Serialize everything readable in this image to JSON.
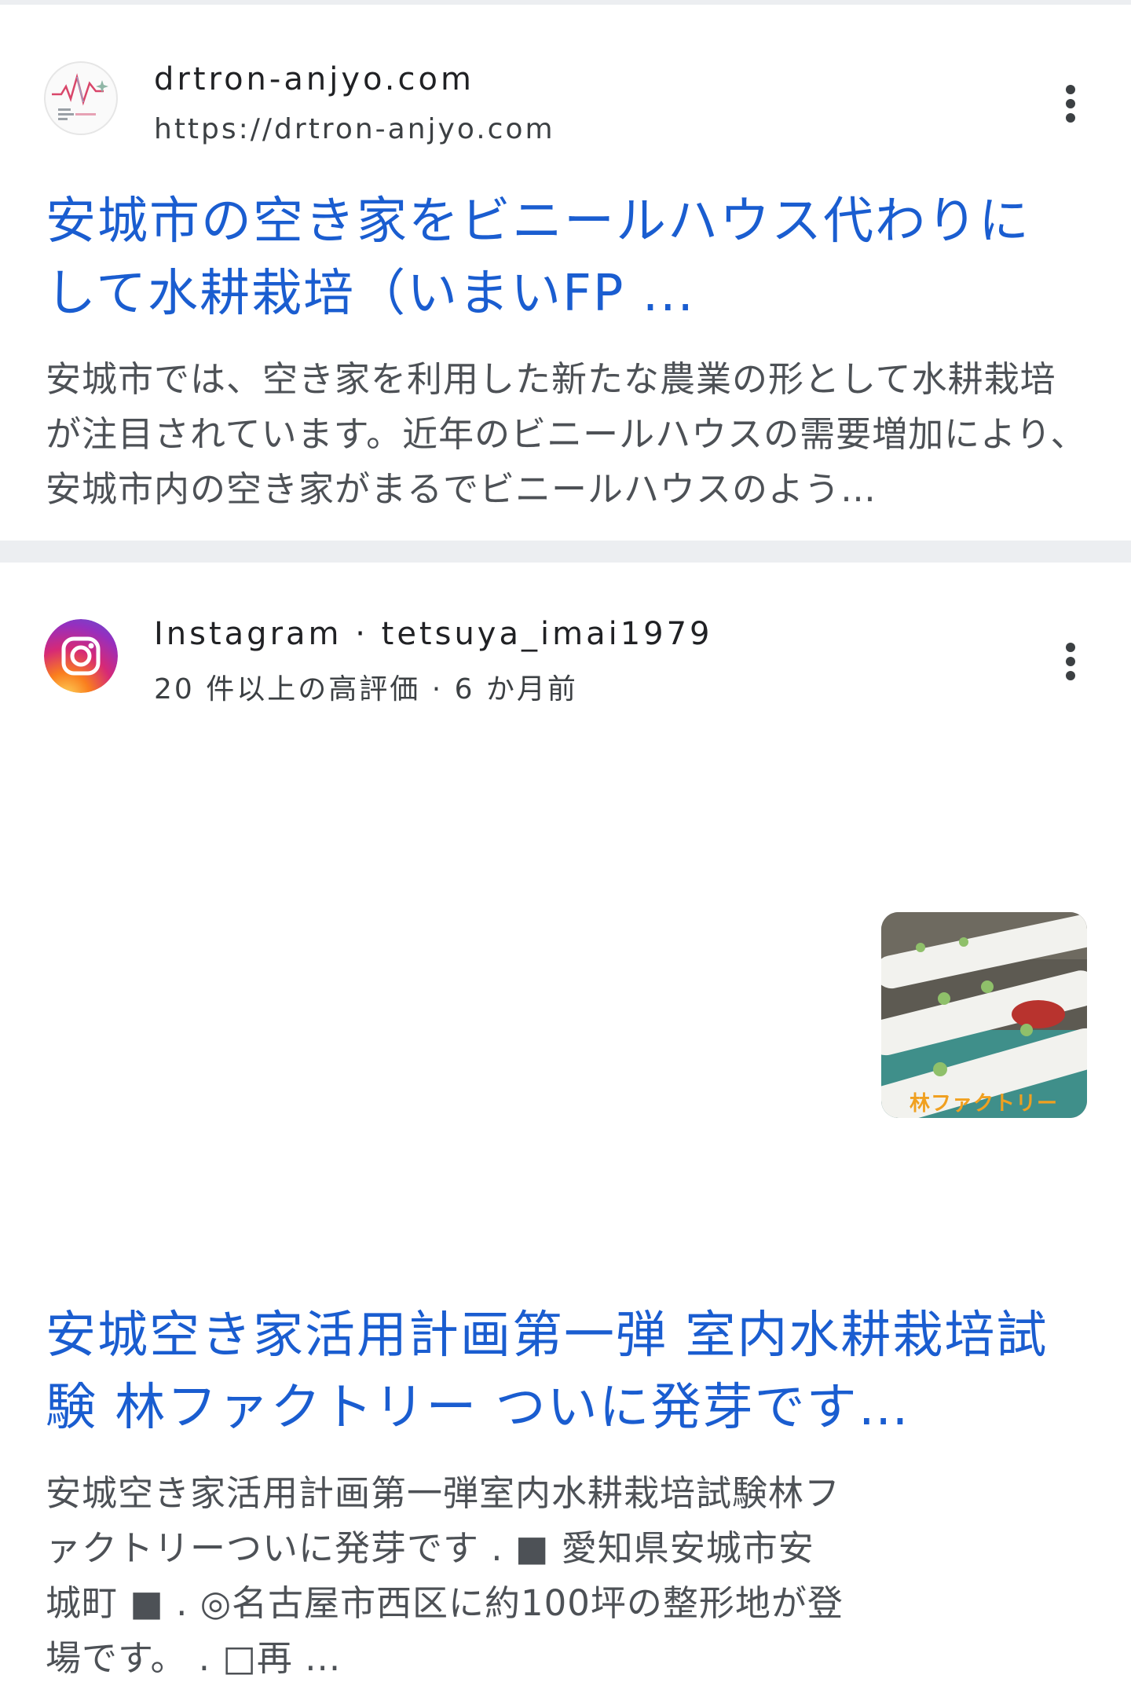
{
  "results": [
    {
      "favicon": "drtron-logo-icon",
      "site_name": "drtron-anjyo.com",
      "site_url": "https://drtron-anjyo.com",
      "title": "安城市の空き家をビニールハウス代わりにして水耕栽培（いまいFP ...",
      "snippet": "安城市では、空き家を利用した新たな農業の形として水耕栽培が注目されています。近年のビニールハウスの需要増加により、安城市内の空き家がまるでビニールハウスのよう…"
    },
    {
      "favicon": "instagram-icon",
      "site_name": "Instagram · tetsuya_imai1979",
      "meta": "20 件以上の高評価 · 6 か月前",
      "title": "安城空き家活用計画第一弾 室内水耕栽培試験 林ファクトリー ついに発芽です…",
      "snippet": "安城空き家活用計画第一弾室内水耕栽培試験林ファクトリーついに発芽です . ■ 愛知県安城市安城町 ■ . ◎名古屋市西区に約100坪の整形地が登場です。 . □再 ...",
      "thumbnail_caption": "林ファクトリー"
    }
  ],
  "colors": {
    "title_link": "#1a5dd0",
    "snippet_text": "#4d5156",
    "divider": "#eceef1"
  }
}
